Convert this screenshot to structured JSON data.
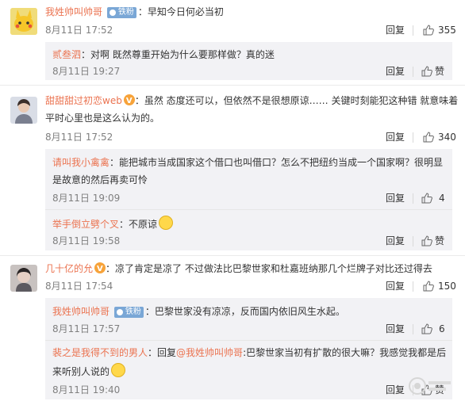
{
  "comments": [
    {
      "user": "我姓帅叫帅哥",
      "badge": "铁粉",
      "text": "早知今日何必当初",
      "time": "8月11日 17:52",
      "reply": "回复",
      "likes": "355",
      "subs": [
        {
          "user": "贰叁泗",
          "text": "对啊 既然尊重开始为什么要那样做？真的迷",
          "time": "8月11日 19:27",
          "reply": "回复",
          "likes": "赞"
        }
      ]
    },
    {
      "user": "甜甜甜过初恋web",
      "text_line1": "虽然 态度还可以，但依然不是很想原谅…… 关键时刻能犯这种错 就意味着",
      "text_line2": "平时心里也是这么认为的。",
      "time": "8月11日 17:52",
      "reply": "回复",
      "likes": "340",
      "subs": [
        {
          "user": "请叫我小禽禽",
          "text_line1": "能把城市当成国家这个借口也叫借口？怎么不把纽约当成一个国家啊？很明显",
          "text_line2": "是故意的然后再卖可怜",
          "time": "8月11日 19:09",
          "reply": "回复",
          "likes": "4"
        },
        {
          "user": "举手倒立劈个叉",
          "text": "不原谅",
          "time": "8月11日 19:58",
          "reply": "回复",
          "likes": "赞"
        }
      ]
    },
    {
      "user": "几十亿的允",
      "text": "凉了肯定是凉了  不过做法比巴黎世家和杜嘉班纳那几个烂牌子对比还过得去",
      "time": "8月11日 17:54",
      "reply": "回复",
      "likes": "150",
      "subs": [
        {
          "user": "我姓帅叫帅哥",
          "badge": "铁粉",
          "text": "巴黎世家没有凉凉，反而国内依旧风生水起。",
          "time": "8月11日 17:57",
          "reply": "回复",
          "likes": "6"
        },
        {
          "user": "裴之是我得不到的男人",
          "reply_prefix": "回复",
          "mention": "@我姓帅叫帅哥",
          "text_line1": ":巴黎世家当初有扩散的很大嘛？我感觉我都是后",
          "text_line2": "来听别人说的",
          "time": "8月11日 19:40",
          "reply": "回复",
          "likes": "赞"
        }
      ]
    }
  ],
  "colors": {
    "username": "#eb7350",
    "meta": "#808080",
    "subbg": "#f2f2f5"
  }
}
